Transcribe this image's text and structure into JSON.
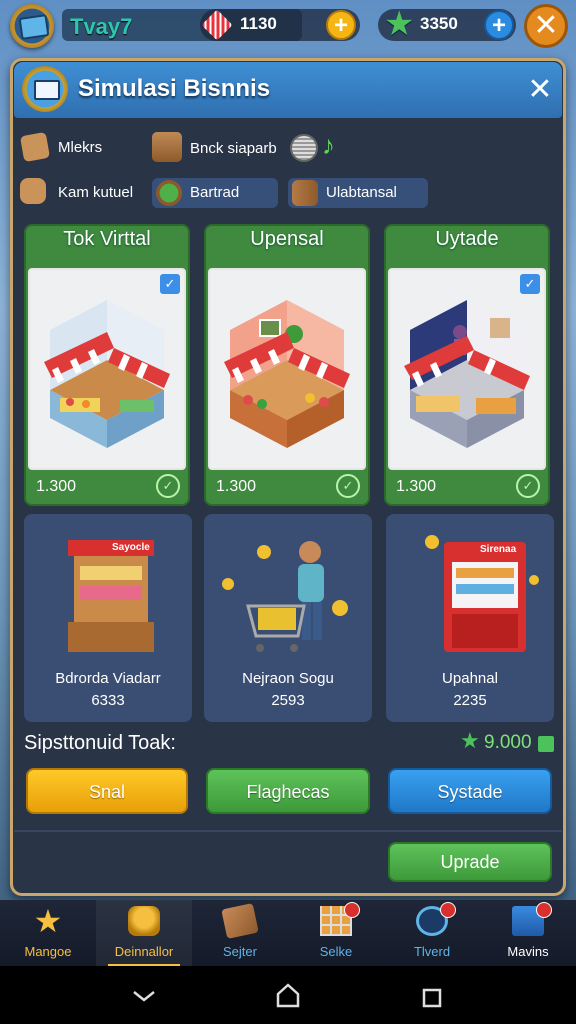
{
  "topbar": {
    "player_name": "Tvay7",
    "coins": "1130",
    "stars": "3350",
    "icons": [
      "avatar-icon",
      "gem-icon",
      "plus-icon",
      "star-icon",
      "plus-icon",
      "close-icon"
    ]
  },
  "panel": {
    "title": "Simulasi Bisnnis",
    "close_glyph": "✕"
  },
  "categories": [
    {
      "label": "Mlekrs",
      "icon": "box-icon"
    },
    {
      "label": "Bnck siaparb",
      "icon": "crate-icon"
    },
    {
      "label": "Kam kutuel",
      "icon": "animal-icon"
    },
    {
      "label": "Bartrad",
      "icon": "plant-icon"
    },
    {
      "label": "Ulabtansal",
      "icon": "barrel-icon"
    }
  ],
  "stores": [
    {
      "title": "Tok Virttal",
      "price": "1.300",
      "selected": true
    },
    {
      "title": "Upensal",
      "price": "1.300",
      "selected": false
    },
    {
      "title": "Uytade",
      "price": "1.300",
      "selected": true
    }
  ],
  "items": [
    {
      "name": "Bdrorda Viadarr",
      "value": "6333",
      "sign": "Sayocle"
    },
    {
      "name": "Nejraon Sogu",
      "value": "2593"
    },
    {
      "name": "Upahnal",
      "value": "2235",
      "sign": "Sirenaa"
    }
  ],
  "summary": {
    "label": "Sipsttonuid Toak:",
    "value": "9.000"
  },
  "buttons": {
    "yellow": "Snal",
    "green": "Flaghecas",
    "blue": "Systade",
    "upgrade": "Uprade"
  },
  "nav": [
    {
      "label": "Mangoe",
      "icon": "star-icon",
      "active": false,
      "badge": false
    },
    {
      "label": "Deinnallor",
      "icon": "basket-icon",
      "active": true,
      "badge": false
    },
    {
      "label": "Sejter",
      "icon": "hammer-icon",
      "active": false,
      "badge": false
    },
    {
      "label": "Selke",
      "icon": "grid-icon",
      "active": false,
      "badge": true
    },
    {
      "label": "Tlverd",
      "icon": "globe-icon",
      "active": false,
      "badge": true
    },
    {
      "label": "Mavins",
      "icon": "building-icon",
      "active": false,
      "badge": true
    }
  ],
  "colors": {
    "panel_bg": "#2a3447",
    "title_bar": "#3f8fd4",
    "store_green": "#3f8a3e",
    "item_card": "#3a4d72",
    "btn_yellow": "#f5b614",
    "btn_green": "#4caf48",
    "btn_blue": "#2a8be0",
    "nav_active": "#f5c040"
  }
}
